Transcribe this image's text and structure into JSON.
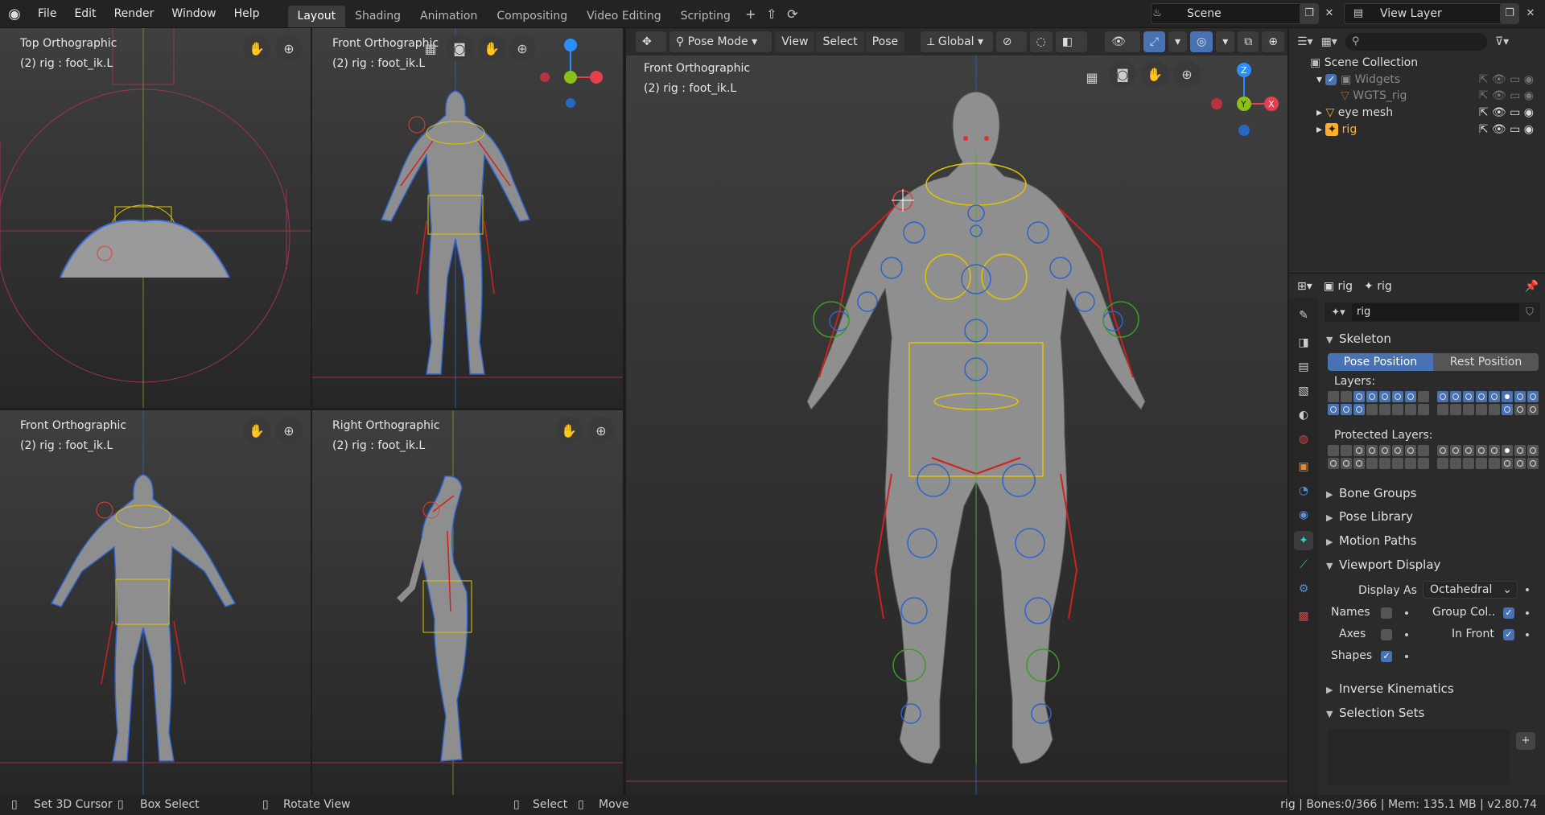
{
  "menu": [
    "File",
    "Edit",
    "Render",
    "Window",
    "Help"
  ],
  "workspaces": [
    "Layout",
    "Shading",
    "Animation",
    "Compositing",
    "Video Editing",
    "Scripting"
  ],
  "scene": "Scene",
  "view_layer": "View Layer",
  "viewports": {
    "top": {
      "title": "Top Orthographic",
      "sub": "(2) rig : foot_ik.L"
    },
    "front_small": {
      "title": "Front Orthographic",
      "sub": "(2) rig : foot_ik.L"
    },
    "front_bottom": {
      "title": "Front Orthographic",
      "sub": "(2) rig : foot_ik.L"
    },
    "right": {
      "title": "Right Orthographic",
      "sub": "(2) rig : foot_ik.L"
    },
    "main": {
      "title": "Front Orthographic",
      "sub": "(2) rig : foot_ik.L"
    }
  },
  "header": {
    "mode": "Pose Mode",
    "view": "View",
    "select": "Select",
    "pose": "Pose",
    "orientation": "Global"
  },
  "gizmo": {
    "x": "X",
    "y": "Y",
    "z": "Z"
  },
  "outliner": {
    "root": "Scene Collection",
    "items": [
      "Widgets",
      "WGTS_rig",
      "eye mesh",
      "rig"
    ]
  },
  "properties": {
    "object": "rig",
    "data": "rig",
    "name_field": "rig",
    "skeleton": "Skeleton",
    "pose_position": "Pose Position",
    "rest_position": "Rest Position",
    "layers": "Layers:",
    "protected_layers": "Protected Layers:",
    "panels": [
      "Bone Groups",
      "Pose Library",
      "Motion Paths",
      "Viewport Display",
      "Inverse Kinematics",
      "Selection Sets"
    ],
    "display_as_label": "Display As",
    "display_as_value": "Octahedral",
    "names": "Names",
    "group_colors": "Group Col..",
    "axes": "Axes",
    "in_front": "In Front",
    "shapes": "Shapes"
  },
  "status": {
    "set_cursor": "Set 3D Cursor",
    "box_select": "Box Select",
    "rotate": "Rotate View",
    "select": "Select",
    "move": "Move",
    "info": "rig | Bones:0/366 | Mem: 135.1 MB | v2.80.74"
  },
  "colors": {
    "accent": "#4772b3",
    "selected": "#ffaf29",
    "axis_x": "#e53e4d",
    "axis_y": "#8ac01a",
    "axis_z": "#2c8fff"
  }
}
